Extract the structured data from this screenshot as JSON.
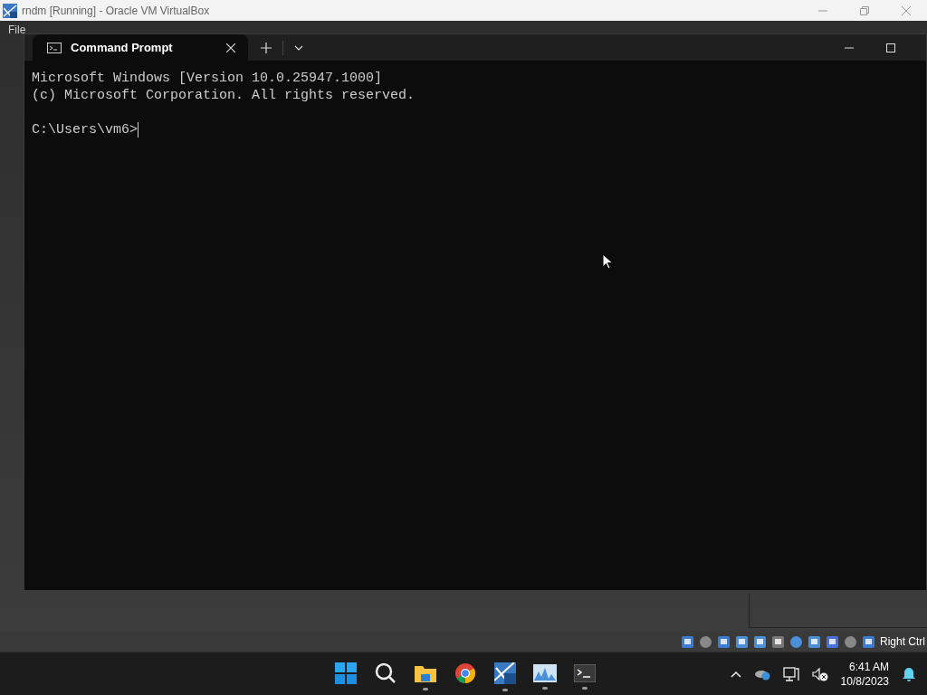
{
  "host_window": {
    "title": "rndm [Running] - Oracle VM VirtualBox"
  },
  "host_menu": [
    {
      "label": "File"
    }
  ],
  "terminal": {
    "tabs": [
      {
        "title": "Command Prompt",
        "selected": true
      }
    ],
    "lines": [
      "Microsoft Windows [Version 10.0.25947.1000]",
      "(c) Microsoft Corporation. All rights reserved."
    ],
    "prompt": "C:\\Users\\vm6>"
  },
  "status_bar": {
    "host_key": "Right Ctrl"
  },
  "taskbar": {
    "apps": [
      {
        "kind": "start",
        "running": false
      },
      {
        "kind": "search",
        "running": false
      },
      {
        "kind": "folder",
        "running": true
      },
      {
        "kind": "browser",
        "running": false
      },
      {
        "kind": "vbox",
        "running": true
      },
      {
        "kind": "monitor",
        "running": true
      },
      {
        "kind": "terminal",
        "running": true
      }
    ],
    "time": "6:41 AM",
    "date": "10/8/2023"
  }
}
